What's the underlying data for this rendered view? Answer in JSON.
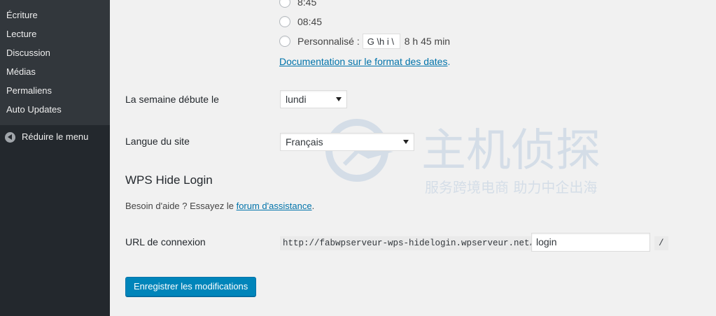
{
  "sidebar": {
    "items": [
      {
        "label": "Écriture"
      },
      {
        "label": "Lecture"
      },
      {
        "label": "Discussion"
      },
      {
        "label": "Médias"
      },
      {
        "label": "Permaliens"
      },
      {
        "label": "Auto Updates"
      }
    ],
    "collapse_label": "Réduire le menu"
  },
  "time_format": {
    "options": [
      {
        "label": "8:45"
      },
      {
        "label": "08:45"
      },
      {
        "label": "Personnalisé :"
      }
    ],
    "custom_value": "G \\h i \\",
    "custom_preview": "8 h 45 min",
    "doc_link": "Documentation sur le format des dates",
    "doc_link_suffix": "."
  },
  "week_start": {
    "label": "La semaine débute le",
    "value": "lundi"
  },
  "site_language": {
    "label": "Langue du site",
    "value": "Français"
  },
  "wps_hide_login": {
    "title": "WPS Hide Login",
    "help_prefix": "Besoin d'aide ? Essayez le ",
    "help_link": "forum d'assistance",
    "help_suffix": ".",
    "url_label": "URL de connexion",
    "url_prefix": "http://fabwpserveur-wps-hidelogin.wpserveur.net/",
    "login_value": "login",
    "url_suffix": "/"
  },
  "save_button": "Enregistrer les modifications",
  "watermark": {
    "title": "主机侦探",
    "subtitle": "服务跨境电商 助力中企出海"
  },
  "colors": {
    "sidebar_bg": "#23282d",
    "submenu_bg": "#32373c",
    "link": "#0073aa",
    "primary_button": "#0085ba"
  }
}
